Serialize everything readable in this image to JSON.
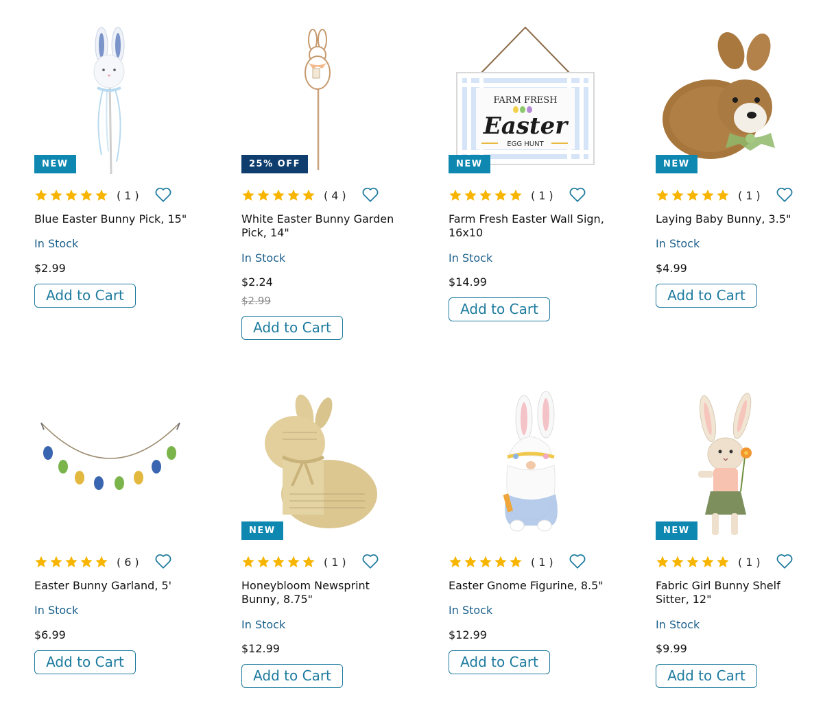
{
  "products": [
    {
      "name": "Blue Easter Bunny Pick, 15\"",
      "badge": "NEW",
      "reviews": "(1)",
      "stock": "In Stock",
      "price": "$2.99",
      "old_price": "",
      "button": "Add to Cart",
      "image": "blue-bunny-pick-image"
    },
    {
      "name": "White Easter Bunny Garden Pick, 14\"",
      "badge": "25% OFF",
      "reviews": "(4)",
      "stock": "In Stock",
      "price": "$2.24",
      "old_price": "$2.99",
      "button": "Add to Cart",
      "image": "white-bunny-garden-pick-image"
    },
    {
      "name": "Farm Fresh Easter Wall Sign, 16x10",
      "badge": "NEW",
      "reviews": "(1)",
      "stock": "In Stock",
      "price": "$14.99",
      "old_price": "",
      "button": "Add to Cart",
      "image": "farm-fresh-easter-sign-image",
      "sign": {
        "top": "FARM FRESH",
        "main": "Easter",
        "bottom": "EGG HUNT"
      }
    },
    {
      "name": "Laying Baby Bunny, 3.5\"",
      "badge": "NEW",
      "reviews": "(1)",
      "stock": "In Stock",
      "price": "$4.99",
      "old_price": "",
      "button": "Add to Cart",
      "image": "laying-baby-bunny-image"
    },
    {
      "name": "Easter Bunny Garland, 5'",
      "badge": "",
      "reviews": "(6)",
      "stock": "In Stock",
      "price": "$6.99",
      "old_price": "",
      "button": "Add to Cart",
      "image": "easter-bunny-garland-image"
    },
    {
      "name": "Honeybloom Newsprint Bunny, 8.75\"",
      "badge": "NEW",
      "reviews": "(1)",
      "stock": "In Stock",
      "price": "$12.99",
      "old_price": "",
      "button": "Add to Cart",
      "image": "newsprint-bunny-image"
    },
    {
      "name": "Easter Gnome Figurine, 8.5\"",
      "badge": "",
      "reviews": "(1)",
      "stock": "In Stock",
      "price": "$12.99",
      "old_price": "",
      "button": "Add to Cart",
      "image": "easter-gnome-image"
    },
    {
      "name": "Fabric Girl Bunny Shelf Sitter, 12\"",
      "badge": "NEW",
      "reviews": "(1)",
      "stock": "In Stock",
      "price": "$9.99",
      "old_price": "",
      "button": "Add to Cart",
      "image": "fabric-girl-bunny-image"
    }
  ],
  "star_rating": 5,
  "colors": {
    "badge_new": "#0f88b1",
    "badge_sale": "#0e3d6e",
    "star": "#f7b500",
    "stock": "#1a5f8a",
    "button": "#1d7a9e"
  },
  "icons": {
    "star": "star-icon",
    "wishlist": "heart-outline-icon"
  }
}
